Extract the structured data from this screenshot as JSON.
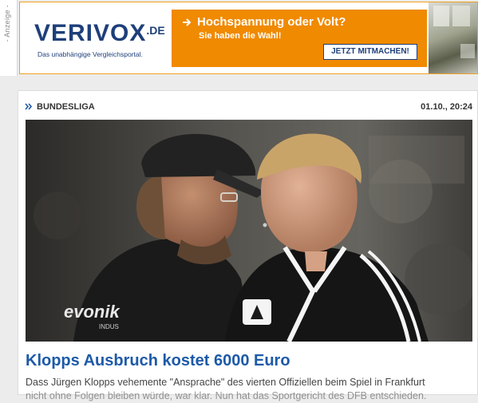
{
  "ad": {
    "side_label": "- Anzeige -",
    "brand_name": "VERIVOX",
    "brand_tld": ".DE",
    "tagline": "Das unabhängige Vergleichsportal.",
    "headline": "Hochspannung oder Volt?",
    "subline": "Sie haben die Wahl!",
    "cta_label": "JETZT MITMACHEN!",
    "arrow_icon": "arrow-right-icon",
    "colors": {
      "brand_blue": "#1e3f7a",
      "accent_orange": "#f08a00"
    }
  },
  "article": {
    "category": "BUNDESLIGA",
    "category_icon": "double-chevron-right-icon",
    "timestamp": "01.10., 20:24",
    "title": "Klopps Ausbruch kostet 6000 Euro",
    "teaser_line1": "Dass Jürgen Klopps vehemente \"Ansprache\" des vierten Offiziellen beim Spiel in Frankfurt",
    "teaser_line2": "nicht ohne Folgen bleiben würde, war klar. Nun hat das Sportgericht des DFB entschieden.",
    "photo_jersey_text": "evonik",
    "photo_jersey_sub": "INDUS",
    "colors": {
      "title_blue": "#1d5aa8"
    }
  }
}
